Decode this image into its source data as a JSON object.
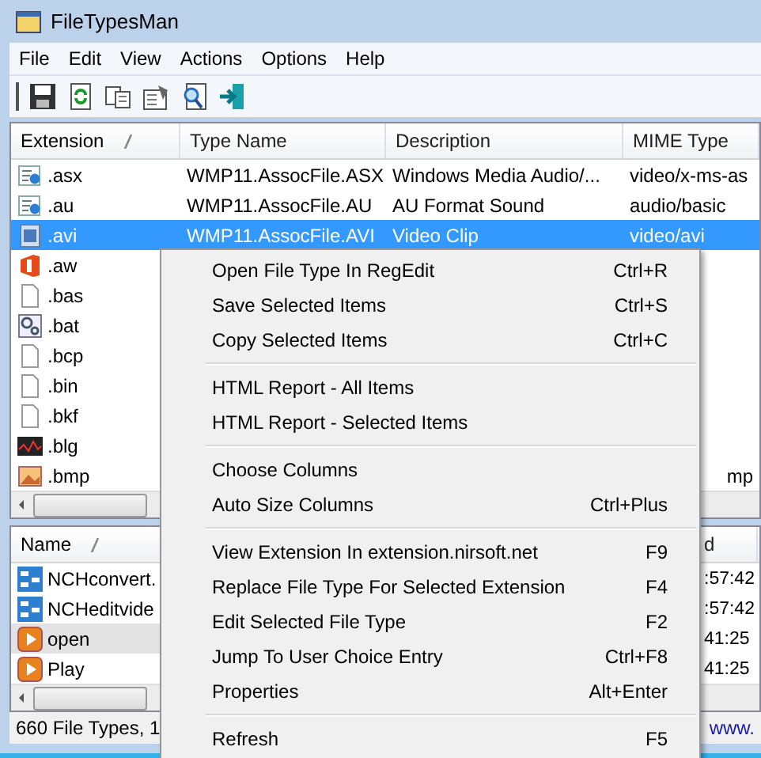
{
  "window": {
    "title": "FileTypesMan"
  },
  "menu_bar": [
    "File",
    "Edit",
    "View",
    "Actions",
    "Options",
    "Help"
  ],
  "file_types": {
    "columns": [
      {
        "label": "Extension",
        "sorted": true
      },
      {
        "label": "Type Name",
        "sorted": false
      },
      {
        "label": "Description",
        "sorted": false
      },
      {
        "label": "MIME Type",
        "sorted": false
      }
    ],
    "rows": [
      {
        "kind": "media",
        "cells": [
          ".asx",
          "WMP11.AssocFile.ASX",
          "Windows Media Audio/...",
          "video/x-ms-as"
        ],
        "selected": false
      },
      {
        "kind": "media",
        "cells": [
          ".au",
          "WMP11.AssocFile.AU",
          "AU Format Sound",
          "audio/basic"
        ],
        "selected": false
      },
      {
        "kind": "video",
        "cells": [
          ".avi",
          "WMP11.AssocFile.AVI",
          "Video Clip",
          "video/avi"
        ],
        "selected": true
      },
      {
        "kind": "office",
        "cells": [
          ".aw"
        ],
        "selected": false
      },
      {
        "kind": "blank",
        "cells": [
          ".bas"
        ],
        "selected": false
      },
      {
        "kind": "gears",
        "cells": [
          ".bat"
        ],
        "selected": false
      },
      {
        "kind": "blank",
        "cells": [
          ".bcp"
        ],
        "selected": false
      },
      {
        "kind": "blank",
        "cells": [
          ".bin"
        ],
        "selected": false
      },
      {
        "kind": "blank",
        "cells": [
          ".bkf"
        ],
        "selected": false
      },
      {
        "kind": "chart",
        "cells": [
          ".blg"
        ],
        "selected": false
      },
      {
        "kind": "image",
        "cells": [
          ".bmp",
          "",
          "",
          "mp"
        ],
        "selected": false
      }
    ]
  },
  "actions": {
    "columns": [
      {
        "label": "Name",
        "sorted": true
      },
      {
        "label": "d",
        "sorted": false
      }
    ],
    "rows": [
      {
        "kind": "app",
        "cells": [
          "NCHconvert.",
          ":57:42"
        ],
        "selected": false
      },
      {
        "kind": "app",
        "cells": [
          "NCHeditvide",
          ":57:42"
        ],
        "selected": false
      },
      {
        "kind": "play",
        "cells": [
          "open",
          "41:25"
        ],
        "selected": true
      },
      {
        "kind": "play",
        "cells": [
          "Play",
          "41:25"
        ],
        "selected": false
      }
    ]
  },
  "status_bar": {
    "text": "660 File Types, 1",
    "link": "www."
  },
  "context_menu": [
    [
      {
        "label": "Open File Type In RegEdit",
        "shortcut": "Ctrl+R"
      },
      {
        "label": "Save Selected Items",
        "shortcut": "Ctrl+S"
      },
      {
        "label": "Copy Selected Items",
        "shortcut": "Ctrl+C"
      }
    ],
    [
      {
        "label": "HTML Report - All Items"
      },
      {
        "label": "HTML Report - Selected Items"
      }
    ],
    [
      {
        "label": "Choose Columns"
      },
      {
        "label": "Auto Size Columns",
        "shortcut": "Ctrl+Plus"
      }
    ],
    [
      {
        "label": "View Extension In extension.nirsoft.net",
        "shortcut": "F9"
      },
      {
        "label": "Replace File Type For Selected Extension",
        "shortcut": "F4"
      },
      {
        "label": "Edit Selected File Type",
        "shortcut": "F2"
      },
      {
        "label": "Jump To User Choice Entry",
        "shortcut": "Ctrl+F8"
      },
      {
        "label": "Properties",
        "shortcut": "Alt+Enter"
      }
    ],
    [
      {
        "label": "Refresh",
        "shortcut": "F5"
      }
    ]
  ]
}
